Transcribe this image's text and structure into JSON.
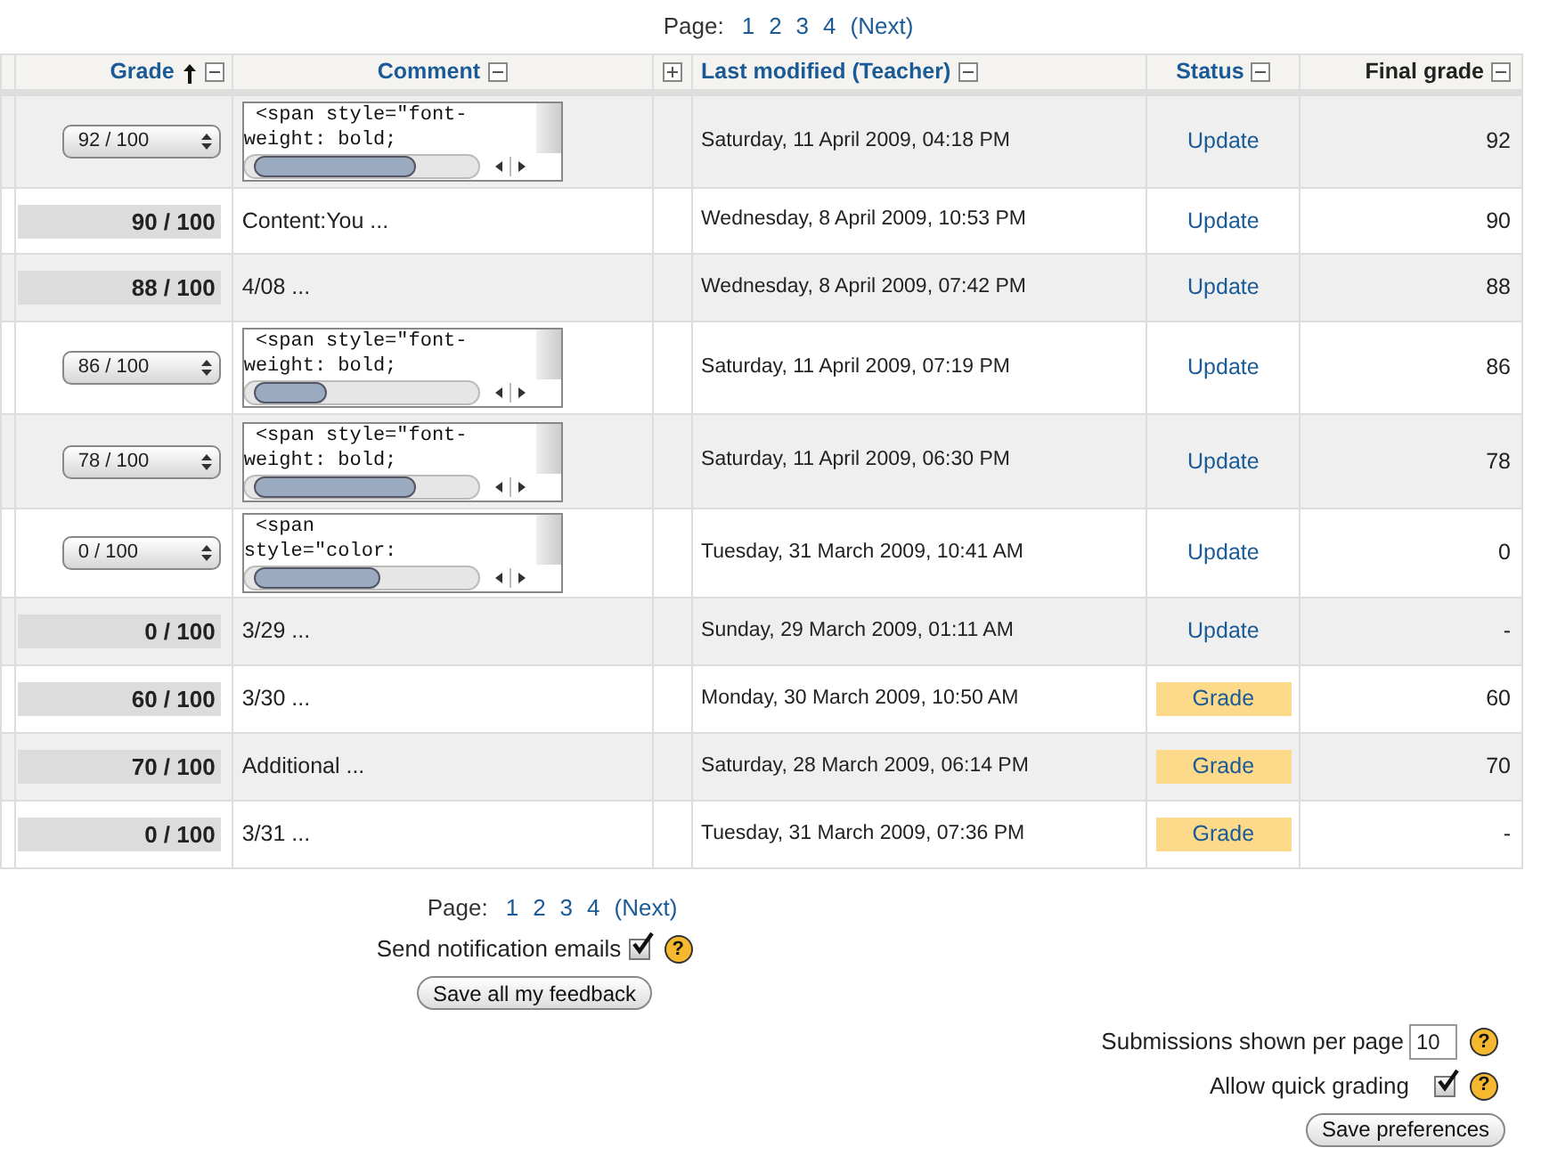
{
  "pager_top": {
    "label": "Page:",
    "pages": [
      "1",
      "2",
      "3",
      "4"
    ],
    "next": "(Next)"
  },
  "columns": [
    {
      "label": "Grade",
      "sort": true,
      "collapsed": false
    },
    {
      "label": "Comment",
      "collapsed": false
    },
    {
      "collapsed": true
    },
    {
      "label": "Last modified (Teacher)",
      "collapsed": false
    },
    {
      "label": "Status",
      "collapsed": false
    },
    {
      "label": "Final grade",
      "collapsed": false
    }
  ],
  "rows": [
    {
      "kind": "editable",
      "grade": "92 / 100",
      "comment": " <span style=\"font-\nweight: bold;",
      "modified": "Saturday, 11 April 2009, 04:18 PM",
      "status": {
        "label": "Update",
        "kind": "link"
      },
      "final": "92"
    },
    {
      "kind": "static",
      "grade": "90 / 100",
      "comment": "Content:You ...",
      "modified": "Wednesday, 8 April 2009, 10:53 PM",
      "status": {
        "label": "Update",
        "kind": "link"
      },
      "final": "90"
    },
    {
      "kind": "static",
      "grade": "88 / 100",
      "comment": "4/08 ...",
      "modified": "Wednesday, 8 April 2009, 07:42 PM",
      "status": {
        "label": "Update",
        "kind": "link"
      },
      "final": "88"
    },
    {
      "kind": "editable",
      "grade": "86 / 100",
      "comment": " <span style=\"font-\nweight: bold;",
      "modified": "Saturday, 11 April 2009, 07:19 PM",
      "status": {
        "label": "Update",
        "kind": "link"
      },
      "final": "86"
    },
    {
      "kind": "editable",
      "grade": "78 / 100",
      "comment": " <span style=\"font-\nweight: bold;",
      "modified": "Saturday, 11 April 2009, 06:30 PM",
      "status": {
        "label": "Update",
        "kind": "link"
      },
      "final": "78"
    },
    {
      "kind": "editable",
      "grade": "0 / 100",
      "comment": " <span\nstyle=\"color:",
      "modified": "Tuesday, 31 March 2009, 10:41 AM",
      "status": {
        "label": "Update",
        "kind": "link"
      },
      "final": "0"
    },
    {
      "kind": "static",
      "grade": "0 / 100",
      "comment": "3/29 ...",
      "modified": "Sunday, 29 March 2009, 01:11 AM",
      "status": {
        "label": "Update",
        "kind": "link"
      },
      "final": "-"
    },
    {
      "kind": "static",
      "grade": "60 / 100",
      "comment": "3/30 ...",
      "modified": "Monday, 30 March 2009, 10:50 AM",
      "status": {
        "label": "Grade",
        "kind": "button"
      },
      "final": "60"
    },
    {
      "kind": "static",
      "grade": "70 / 100",
      "comment": "Additional ...",
      "modified": "Saturday, 28 March 2009, 06:14 PM",
      "status": {
        "label": "Grade",
        "kind": "button"
      },
      "final": "70"
    },
    {
      "kind": "static",
      "grade": "0 / 100",
      "comment": "3/31 ...",
      "modified": "Tuesday, 31 March 2009, 07:36 PM",
      "status": {
        "label": "Grade",
        "kind": "button"
      },
      "final": "-"
    }
  ],
  "pager_bottom": {
    "label": "Page:",
    "pages": [
      "1",
      "2",
      "3",
      "4"
    ],
    "next": "(Next)"
  },
  "notify": {
    "label": "Send notification emails",
    "checked": true,
    "help": "?"
  },
  "save_feedback": "Save all my feedback",
  "per_page": {
    "label": "Submissions shown per page",
    "value": "10",
    "help": "?"
  },
  "quick_grading": {
    "label": "Allow quick grading",
    "checked": true,
    "help": "?"
  },
  "save_preferences": "Save preferences"
}
